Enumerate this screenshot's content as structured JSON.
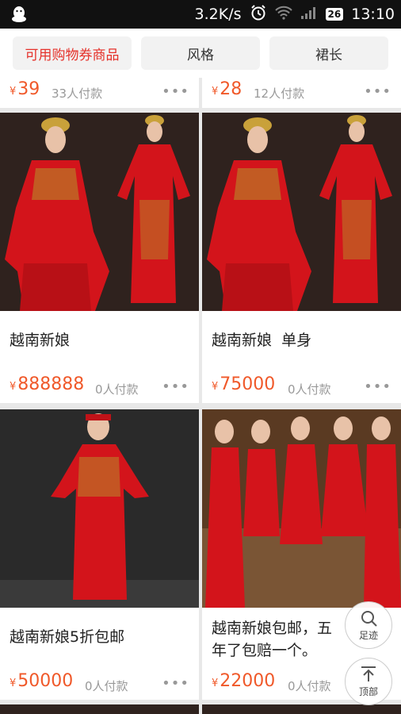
{
  "status_bar": {
    "speed": "3.2K/s",
    "battery": "26",
    "time": "13:10"
  },
  "filters": [
    {
      "label": "可用购物券商品"
    },
    {
      "label": "风格"
    },
    {
      "label": "裙长"
    }
  ],
  "products": [
    {
      "currency": "¥",
      "price": "39",
      "sold": "33人付款"
    },
    {
      "currency": "¥",
      "price": "28",
      "sold": "12人付款"
    },
    {
      "title": "越南新娘",
      "currency": "¥",
      "price": "888888",
      "sold": "0人付款"
    },
    {
      "title": "越南新娘  单身",
      "currency": "¥",
      "price": "75000",
      "sold": "0人付款"
    },
    {
      "title": "越南新娘5折包邮",
      "currency": "¥",
      "price": "50000",
      "sold": "0人付款"
    },
    {
      "title": "越南新娘包邮，五年了包赔一个。",
      "currency": "¥",
      "price": "22000",
      "sold": "0人付款"
    }
  ],
  "float_buttons": {
    "footprint": "足迹",
    "top": "顶部"
  },
  "more_glyph": "•••",
  "colors": {
    "accent": "#e5322b",
    "price": "#f0592a",
    "dress_red": "#d3141b"
  },
  "icons": {
    "status_left": "qq-penguin-icon",
    "footprint": "footprint-icon",
    "top": "arrow-up-icon"
  }
}
